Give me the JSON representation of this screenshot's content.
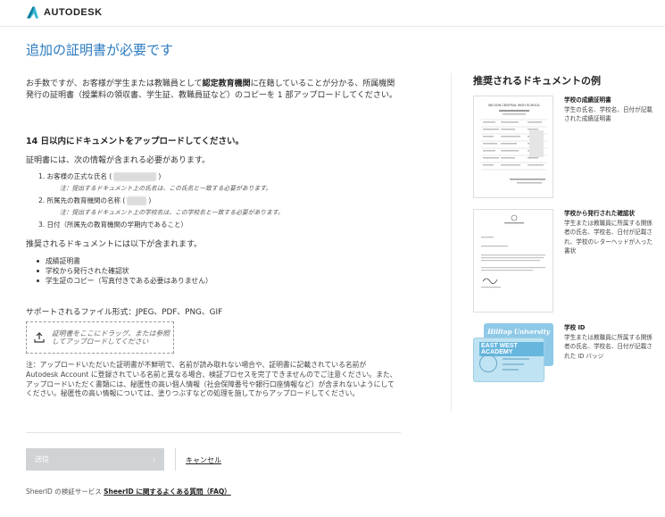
{
  "header": {
    "brand": "AUTODESK"
  },
  "page_title": "追加の証明書が必要です",
  "main": {
    "intro_pre": "お手数ですが、お客様が学生または教職員として",
    "intro_bold": "認定教育機関",
    "intro_post": "に在籍していることが分かる、所属機関発行の証明書（授業料の領収書、学生証、教職員証など）のコピーを 1 部アップロードしてください。",
    "deadline": "14 日以内にドキュメントをアップロードしてください。",
    "requirements_intro": "証明書には、次の情報が含まれる必要があります。",
    "requirements": [
      {
        "pre": "1. お客様の正式な氏名 (",
        "post": ")",
        "note": "注：提出するドキュメント上の氏名は、この氏名と一致する必要があります。"
      },
      {
        "pre": "2. 所属先の教育機関の名称 (",
        "post": ")",
        "note": "注：提出するドキュメント上の学校名は、この学校名と一致する必要があります。"
      },
      {
        "pre": "3. 日付（所属先の教育機関の学期内であること）",
        "post": "",
        "note": ""
      }
    ],
    "recommended_intro": "推奨されるドキュメントには以下が含まれます。",
    "recommended": [
      "成績証明書",
      "学校から発行された確認状",
      "学生証のコピー（写真付きである必要はありません）"
    ],
    "formats": "サポートされるファイル形式：JPEG、PDF、PNG、GIF",
    "dropzone_text": "証明書をここにドラッグ、または参照してアップロードしてください",
    "notice": "注：アップロードいただいた証明書が不鮮明で、名前が読み取れない場合や、証明書に記載されている名前が Autodesk Account に登録されている名前と異なる場合、検証プロセスを完了できませんのでご注意ください。また、アップロードいただく書類には、秘匿性の高い個人情報（社会保障番号や銀行口座情報など）が含まれないようにしてください。秘匿性の高い情報については、塗りつぶすなどの処理を施してからアップロードしてください。"
  },
  "actions": {
    "submit_label": "送信",
    "submit_arrow": "›",
    "cancel_label": "キャンセル"
  },
  "footer": {
    "faq_pre": "SheerID の検証サービス ",
    "faq_link": "SheerID に関するよくある質問（FAQ）"
  },
  "sidebar": {
    "title": "推奨されるドキュメントの例",
    "docs": [
      {
        "title": "学校の成績証明書",
        "desc": "学生の氏名、学校名、日付が記載された成績証明書",
        "doc_heading": "WILSON CENTRAL HIGH SCHOOL"
      },
      {
        "title": "学校から発行された確認状",
        "desc": "学生または教職員に所属する関係者の氏名、学校名、日付が記載され、学校のレターヘッドが入った書状"
      },
      {
        "title": "学校 ID",
        "desc": "学生または教職員に所属する関係者の氏名、学校名、日付が記載された ID バッジ",
        "card_back": "Hilltop University",
        "card_front": "EAST WEST ACADEMY"
      }
    ]
  },
  "colors": {
    "title_blue": "#2b7bc0",
    "button_disabled": "#cfd3d6"
  }
}
